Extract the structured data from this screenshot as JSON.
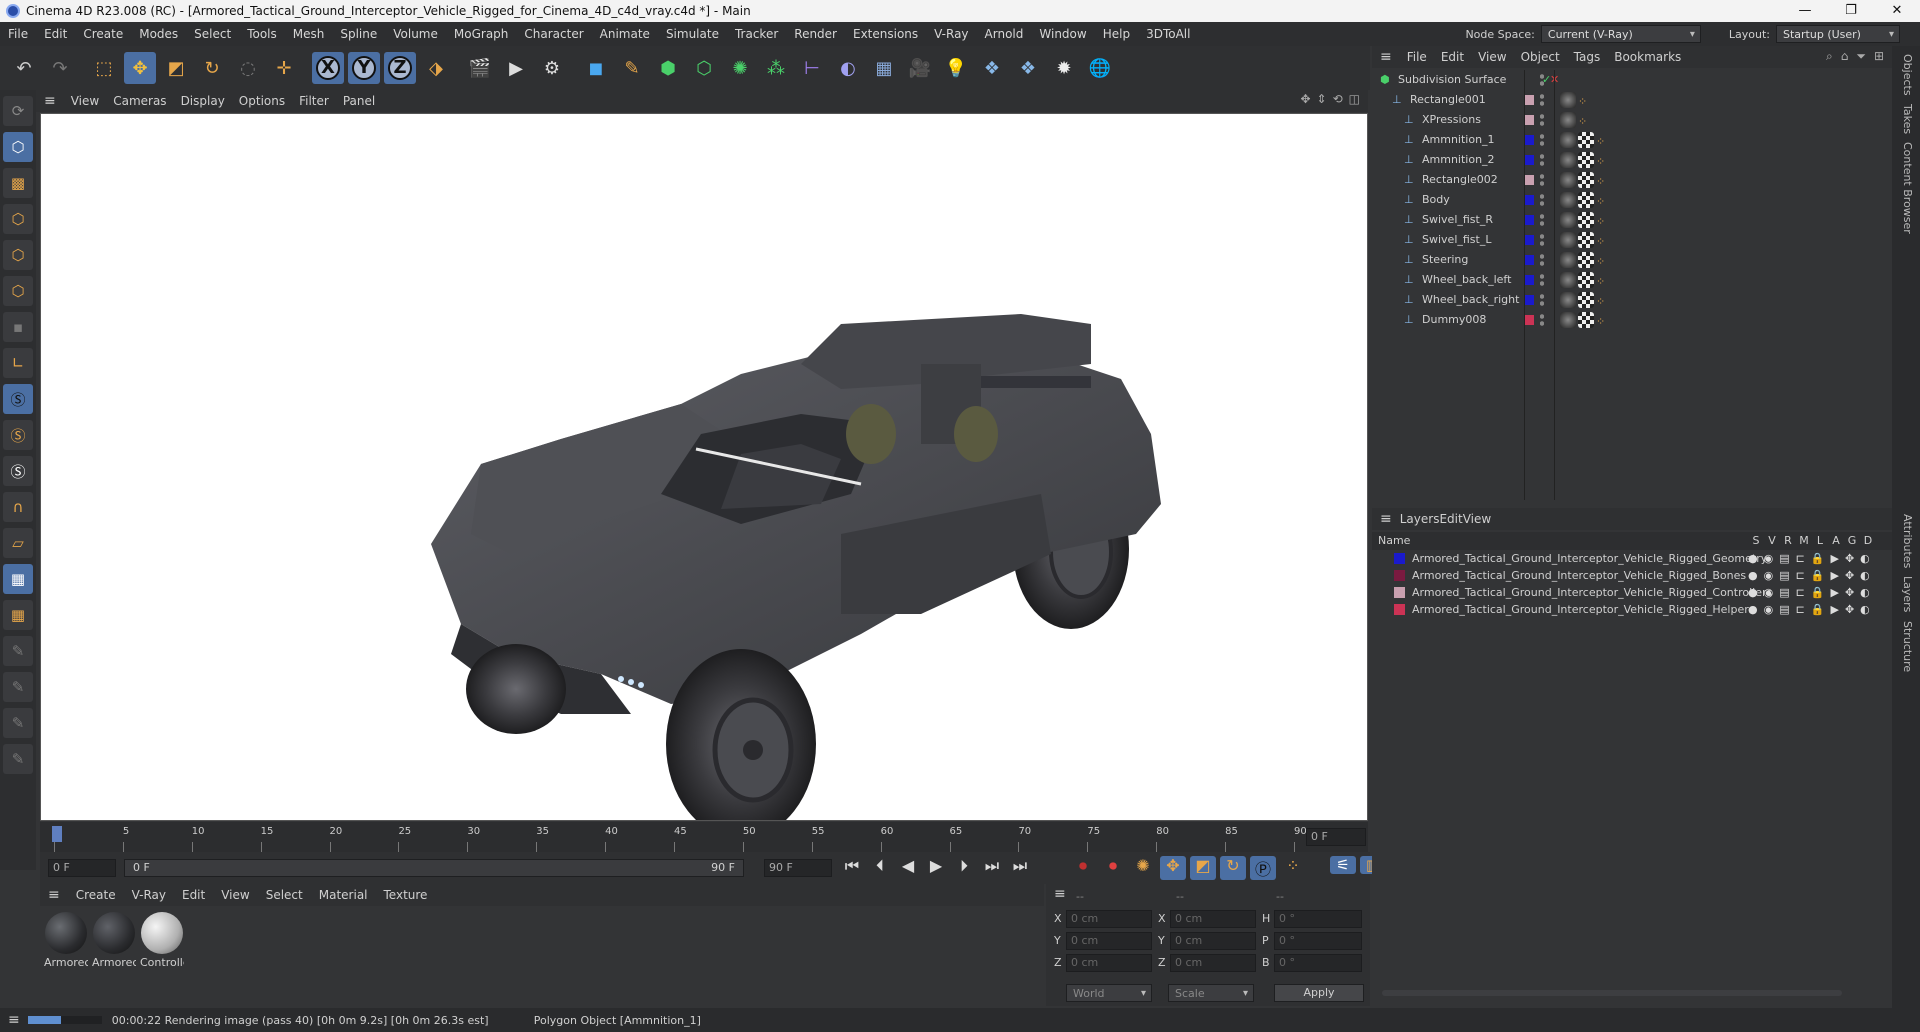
{
  "window": {
    "title": "Cinema 4D R23.008 (RC) - [Armored_Tactical_Ground_Interceptor_Vehicle_Rigged_for_Cinema_4D_c4d_vray.c4d *] - Main",
    "minimize": "—",
    "maximize": "❐",
    "close": "✕"
  },
  "menubar": {
    "items": [
      "File",
      "Edit",
      "Create",
      "Modes",
      "Select",
      "Tools",
      "Mesh",
      "Spline",
      "Volume",
      "MoGraph",
      "Character",
      "Animate",
      "Simulate",
      "Tracker",
      "Render",
      "Extensions",
      "V-Ray",
      "Arnold",
      "Window",
      "Help",
      "3DToAll"
    ],
    "node_space_label": "Node Space:",
    "node_space_value": "Current (V-Ray)",
    "layout_label": "Layout:",
    "layout_value": "Startup (User)"
  },
  "viewport_menu": {
    "items": [
      "View",
      "Cameras",
      "Display",
      "Options",
      "Filter",
      "Panel"
    ]
  },
  "timeline": {
    "ticks": [
      "0",
      "5",
      "10",
      "15",
      "20",
      "25",
      "30",
      "35",
      "40",
      "45",
      "50",
      "55",
      "60",
      "65",
      "70",
      "75",
      "80",
      "85",
      "90"
    ],
    "frame_display": "0 F",
    "start_frame": "0 F",
    "range_start": "0 F",
    "range_end": "90 F",
    "end_frame": "90 F"
  },
  "material_menu": {
    "items": [
      "Create",
      "V-Ray",
      "Edit",
      "View",
      "Select",
      "Material",
      "Texture"
    ]
  },
  "materials": [
    {
      "label": "Armorec"
    },
    {
      "label": "Armorec"
    },
    {
      "label": "Controlle"
    }
  ],
  "coords": {
    "header": [
      "--",
      "--",
      "--"
    ],
    "rows": [
      {
        "axis": "X",
        "pos": "0 cm",
        "axis2": "X",
        "size": "0 cm",
        "rot_label": "H",
        "rot": "0 °"
      },
      {
        "axis": "Y",
        "pos": "0 cm",
        "axis2": "Y",
        "size": "0 cm",
        "rot_label": "P",
        "rot": "0 °"
      },
      {
        "axis": "Z",
        "pos": "0 cm",
        "axis2": "Z",
        "size": "0 cm",
        "rot_label": "B",
        "rot": "0 °"
      }
    ],
    "mode1": "World",
    "mode2": "Scale",
    "apply": "Apply"
  },
  "status": {
    "text": "00:00:22 Rendering image (pass 40) [0h  0m  9.2s] [0h  0m 26.3s est]",
    "selection": "Polygon Object [Ammnition_1]",
    "progress": 0.45
  },
  "object_menu": {
    "items": [
      "File",
      "Edit",
      "View",
      "Object",
      "Tags",
      "Bookmarks"
    ]
  },
  "objects": [
    {
      "name": "Subdivision Surface",
      "indent": 0,
      "color": "",
      "check": true
    },
    {
      "name": "Rectangle001",
      "indent": 1,
      "color": "#c9a0b0"
    },
    {
      "name": "XPressions",
      "indent": 2,
      "color": "#c9a0b0"
    },
    {
      "name": "Ammnition_1",
      "indent": 2,
      "color": "#1a1acc"
    },
    {
      "name": "Ammnition_2",
      "indent": 2,
      "color": "#1a1acc"
    },
    {
      "name": "Rectangle002",
      "indent": 2,
      "color": "#c9a0b0"
    },
    {
      "name": "Body",
      "indent": 2,
      "color": "#1a1acc"
    },
    {
      "name": "Swivel_fist_R",
      "indent": 2,
      "color": "#1a1acc"
    },
    {
      "name": "Swivel_fist_L",
      "indent": 2,
      "color": "#1a1acc"
    },
    {
      "name": "Steering",
      "indent": 2,
      "color": "#1a1acc"
    },
    {
      "name": "Wheel_back_left",
      "indent": 2,
      "color": "#1a1acc"
    },
    {
      "name": "Wheel_back_right",
      "indent": 2,
      "color": "#1a1acc"
    },
    {
      "name": "Dummy008",
      "indent": 2,
      "color": "#cc3355"
    }
  ],
  "layers_menu": {
    "items": [
      "Layers",
      "Edit",
      "View"
    ]
  },
  "layers_header": {
    "name": "Name",
    "cols": [
      "S",
      "V",
      "R",
      "M",
      "L",
      "A",
      "G",
      "D"
    ]
  },
  "layers": [
    {
      "name": "Armored_Tactical_Ground_Interceptor_Vehicle_Rigged_Geometry",
      "color": "#1a1acc"
    },
    {
      "name": "Armored_Tactical_Ground_Interceptor_Vehicle_Rigged_Bones",
      "color": "#7a1a40"
    },
    {
      "name": "Armored_Tactical_Ground_Interceptor_Vehicle_Rigged_Controllers",
      "color": "#c9a0b0"
    },
    {
      "name": "Armored_Tactical_Ground_Interceptor_Vehicle_Rigged_Helpers",
      "color": "#cc3355"
    }
  ],
  "side_tabs_top": [
    "Objects",
    "Takes",
    "Content Browser"
  ],
  "side_tabs_bottom": [
    "Attributes",
    "Layers",
    "Structure"
  ]
}
